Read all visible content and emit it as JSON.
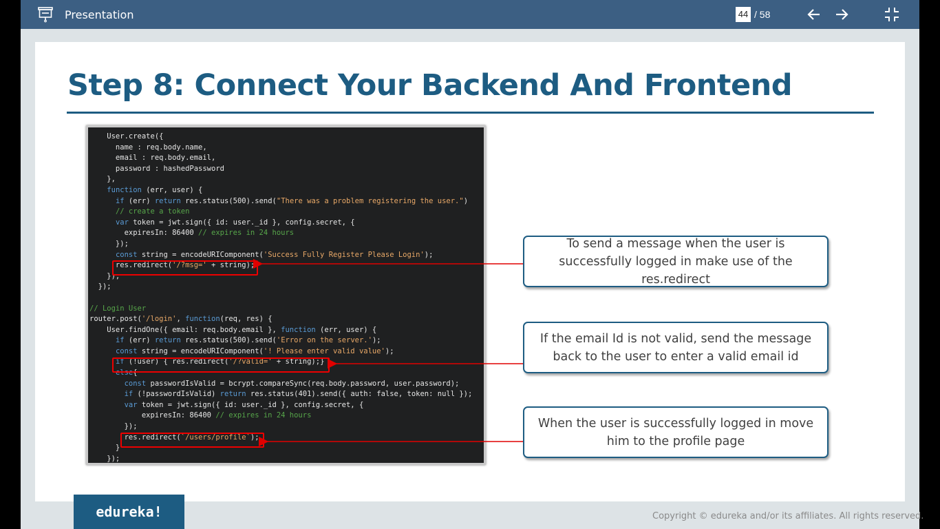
{
  "toolbar": {
    "title": "Presentation",
    "current_page": "44",
    "total_pages": "/ 58",
    "icons": {
      "presentation": "presentation-icon",
      "prev": "arrow-left-icon",
      "next": "arrow-right-icon",
      "exit": "exit-fullscreen-icon"
    }
  },
  "slide": {
    "title": "Step 8: Connect Your Backend And Frontend",
    "callouts": [
      "To send a message when the user is successfully logged in make use of the res.redirect",
      "If the email Id is not valid, send the message back to the user to enter a valid email id",
      "When the user is successfully logged in move him to the profile page"
    ],
    "code_lines": [
      "    User.create({",
      "      name : req.body.name,",
      "      email : req.body.email,",
      "      password : hashedPassword",
      "    },",
      "    function (err, user) {",
      "      if (err) return res.status(500).send(\"There was a problem registering the user.\")",
      "      // create a token",
      "      var token = jwt.sign({ id: user._id }, config.secret, {",
      "        expiresIn: 86400 // expires in 24 hours",
      "      });",
      "      const string = encodeURIComponent('Success Fully Register Please Login');",
      "      res.redirect('/?msg=' + string);",
      "    });",
      "  });",
      "",
      "// Login User",
      "router.post('/login', function(req, res) {",
      "    User.findOne({ email: req.body.email }, function (err, user) {",
      "      if (err) return res.status(500).send('Error on the server.');",
      "      const string = encodeURIComponent('! Please enter valid value');",
      "      if (!user) { res.redirect('/?valid=' + string);}",
      "      else{",
      "        const passwordIsValid = bcrypt.compareSync(req.body.password, user.password);",
      "        if (!passwordIsValid) return res.status(401).send({ auth: false, token: null });",
      "        var token = jwt.sign({ id: user._id }, config.secret, {",
      "            expiresIn: 86400 // expires in 24 hours",
      "        });",
      "        res.redirect(`/users/profile`);",
      "      }",
      "    });"
    ]
  },
  "footer": {
    "logo": "edureka!",
    "copyright": "Copyright © edureka and/or its affiliates. All rights reserved."
  },
  "colors": {
    "toolbar": "#3c5f83",
    "accent": "#1d5c82",
    "highlight": "#e00000",
    "code_bg": "#1f2021"
  }
}
